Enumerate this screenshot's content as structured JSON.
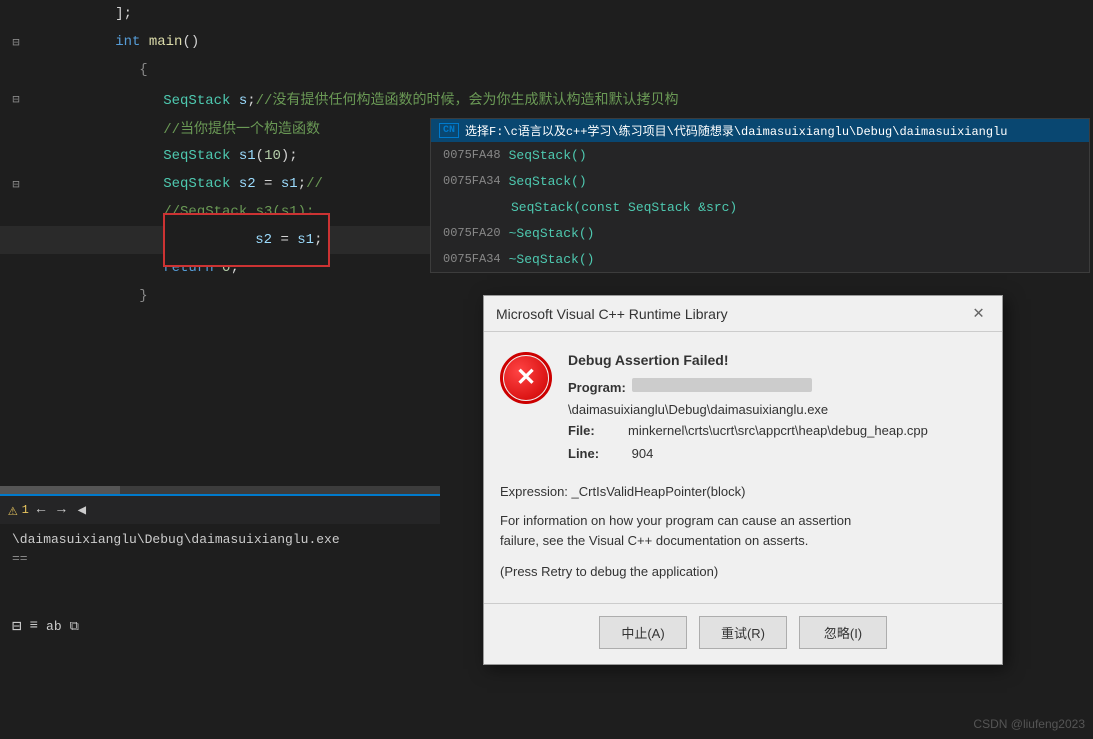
{
  "ide": {
    "background": "#1e1e1e",
    "code_lines": [
      {
        "id": 1,
        "gutter": "⊟",
        "indent": 0,
        "content": "int main()",
        "type": "function_decl"
      },
      {
        "id": 2,
        "gutter": "",
        "indent": 1,
        "content": "{",
        "type": "bracket"
      },
      {
        "id": 3,
        "gutter": "⊟",
        "indent": 2,
        "content": "SeqStack s;//没有提供任何构造函数的时候，会为你生成默认构造和默认拷贝构",
        "type": "code_comment"
      },
      {
        "id": 4,
        "gutter": "",
        "indent": 2,
        "content": "//当你提供一个构造函数",
        "type": "comment_only"
      },
      {
        "id": 5,
        "gutter": "",
        "indent": 2,
        "content": "SeqStack s1(10);",
        "type": "code"
      },
      {
        "id": 6,
        "gutter": "⊟",
        "indent": 2,
        "content": "SeqStack s2 = s1;//SeqStack s3(s1);",
        "type": "code"
      },
      {
        "id": 7,
        "gutter": "",
        "indent": 2,
        "content": "//SeqStack s3(s1);",
        "type": "comment_only"
      },
      {
        "id": 8,
        "gutter": "",
        "indent": 2,
        "content": "s2 = s1;",
        "type": "error_line",
        "highlight": true
      },
      {
        "id": 9,
        "gutter": "",
        "indent": 2,
        "content": "return 0;",
        "type": "code"
      },
      {
        "id": 10,
        "gutter": "",
        "indent": 1,
        "content": "}",
        "type": "bracket"
      }
    ]
  },
  "autocomplete": {
    "header": "选择F:\\c语言以及c++学习\\练习项目\\代码随想录\\daimasuixianglu\\Debug\\daimasuixianglu",
    "items": [
      {
        "id": 1,
        "addr": "0075FA48",
        "name": "SeqStack()"
      },
      {
        "id": 2,
        "addr": "0075FA34",
        "name": "SeqStack()"
      },
      {
        "id": 3,
        "addr": "",
        "name": "SeqStack(const SeqStack &src)"
      },
      {
        "id": 4,
        "addr": "0075FA20",
        "name": "~SeqStack()"
      },
      {
        "id": 5,
        "addr": "0075FA34",
        "name": "~SeqStack()"
      }
    ]
  },
  "bottom_panel": {
    "warning_count": "1",
    "path_line1": "\\daimasuixianglu\\Debug\\daimasuixianglu.exe",
    "path_line2": "=="
  },
  "dialog": {
    "title": "Microsoft Visual C++ Runtime Library",
    "close_label": "✕",
    "heading": "Debug Assertion Failed!",
    "program_label": "Program:",
    "program_path": "\\daimasuixianglu\\Debug\\daimasuixianglu.exe",
    "file_label": "File:",
    "file_path": "minkernel\\crts\\ucrt\\src\\appcrt\\heap\\debug_heap.cpp",
    "line_label": "Line:",
    "line_number": "904",
    "expression_label": "Expression:",
    "expression": "_CrtIsValidHeapPointer(block)",
    "description": "For information on how your program can cause an assertion\nfailure, see the Visual C++ documentation on asserts.",
    "hint": "(Press Retry to debug the application)",
    "buttons": [
      {
        "id": "abort",
        "label": "中止(A)"
      },
      {
        "id": "retry",
        "label": "重试(R)"
      },
      {
        "id": "ignore",
        "label": "忽略(I)"
      }
    ]
  },
  "watermark": {
    "text": "CSDN @liufeng2023"
  }
}
